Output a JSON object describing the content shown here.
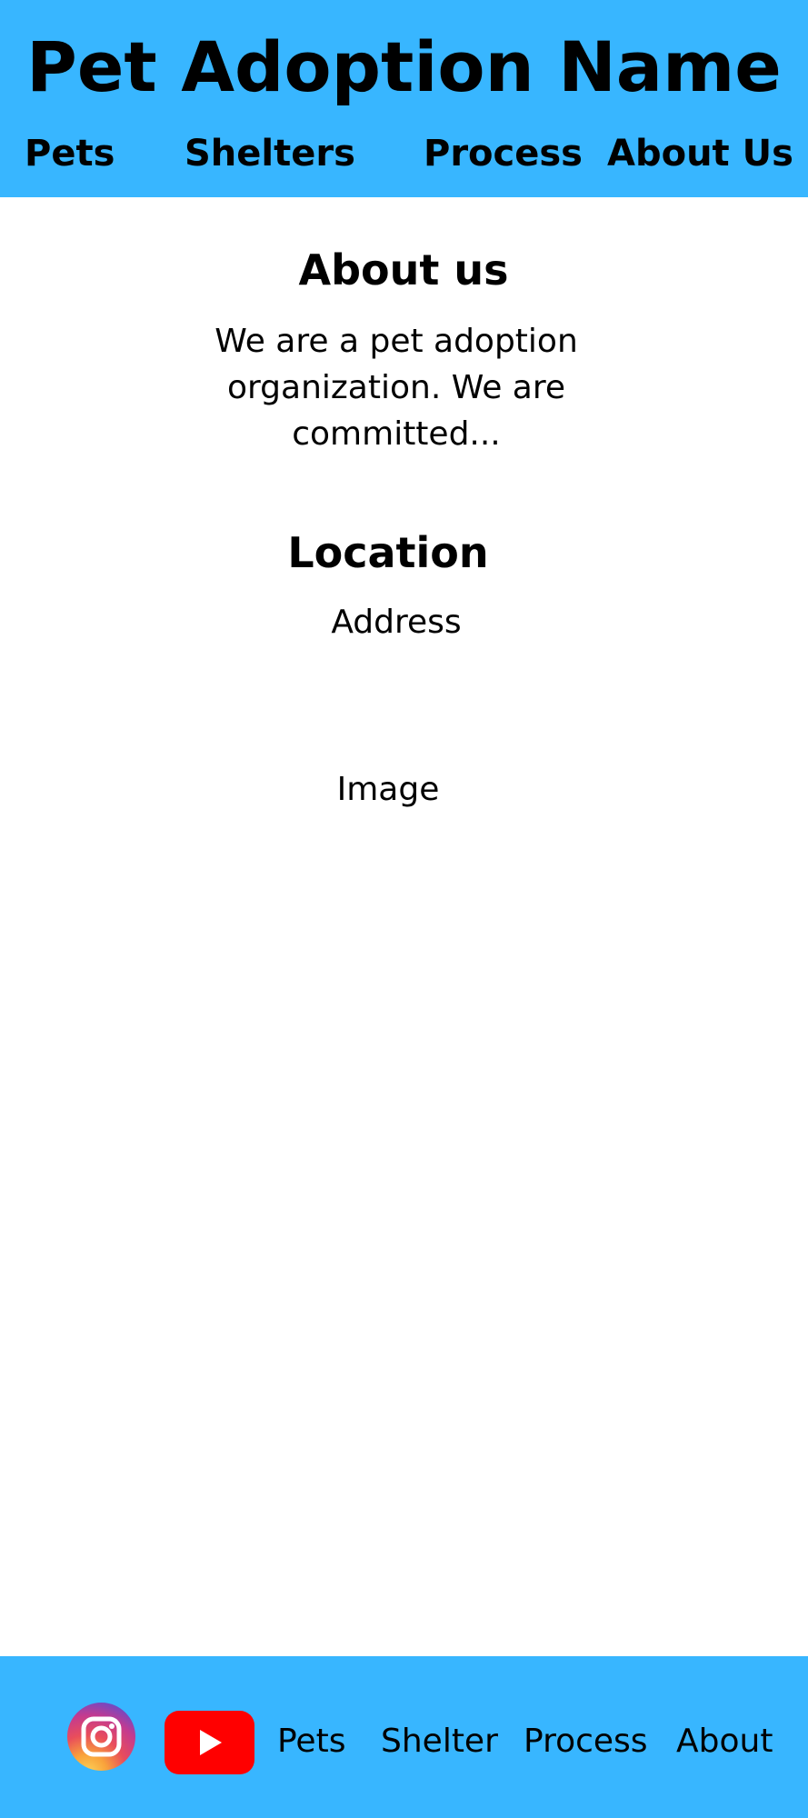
{
  "colors": {
    "header_bg": "#38b6ff",
    "footer_bg": "#38b6ff",
    "page_bg": "#ffffff",
    "text": "#000000",
    "youtube_red": "#ff0000"
  },
  "header": {
    "title": "Pet Adoption Name",
    "nav": [
      {
        "label": "Pets"
      },
      {
        "label": "Shelters"
      },
      {
        "label": "Process"
      },
      {
        "label": "About Us"
      }
    ]
  },
  "main": {
    "about": {
      "title": "About us",
      "text": "We are a pet adoption organization. We are committed..."
    },
    "location": {
      "title": "Location",
      "address": "Address"
    },
    "image_placeholder": "Image"
  },
  "footer": {
    "social": [
      {
        "icon": "instagram-icon"
      },
      {
        "icon": "youtube-icon"
      }
    ],
    "links": [
      {
        "label": "Pets"
      },
      {
        "label": "Shelter"
      },
      {
        "label": "Process"
      },
      {
        "label": "About"
      }
    ]
  }
}
